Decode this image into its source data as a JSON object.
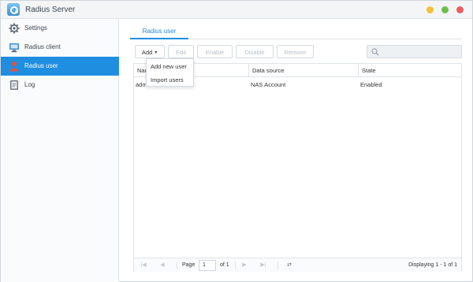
{
  "window": {
    "title": "Radius Server",
    "controls": [
      "minimize",
      "maximize",
      "close"
    ],
    "colors": {
      "minimize": "#f5c036",
      "maximize": "#6cc04a",
      "close": "#ea5e5e"
    }
  },
  "sidebar": {
    "items": [
      {
        "label": "Settings",
        "icon": "gear-icon",
        "active": false
      },
      {
        "label": "Radius client",
        "icon": "monitor-icon",
        "active": false
      },
      {
        "label": "Radius user",
        "icon": "user-icon",
        "active": true
      },
      {
        "label": "Log",
        "icon": "log-icon",
        "active": false
      }
    ]
  },
  "tabs": [
    {
      "label": "Radius user",
      "active": true
    }
  ],
  "toolbar": {
    "add_label": "Add",
    "edit_label": "Edit",
    "enable_label": "Enable",
    "disable_label": "Disable",
    "remove_label": "Remove"
  },
  "add_menu": {
    "items": [
      "Add new user",
      "Import users"
    ]
  },
  "search": {
    "placeholder": "",
    "icon": "search-icon"
  },
  "table": {
    "columns": [
      "Name",
      "Data source",
      "State"
    ],
    "rows": [
      {
        "name": "admin",
        "source": "NAS Account",
        "state": "Enabled"
      }
    ]
  },
  "pager": {
    "page_label": "Page",
    "page_value": "1",
    "of_label": "of 1",
    "display_text": "Displaying 1 - 1 of 1"
  },
  "colors": {
    "accent": "#1f8ee0"
  }
}
